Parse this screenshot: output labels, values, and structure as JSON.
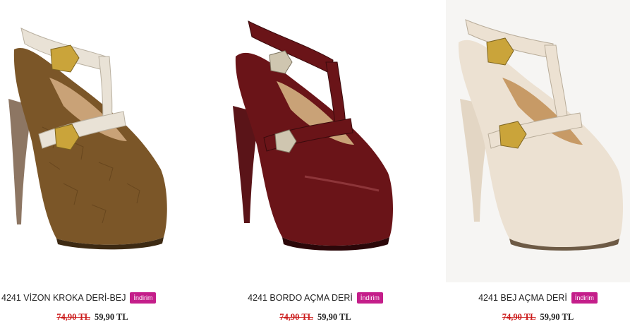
{
  "products": [
    {
      "title": "4241 VİZON KROKA DERİ-BEJ",
      "badge": "İndirim",
      "old_price": "74,90 TL",
      "new_price": "59,90 TL",
      "image": "brown-croc-tstrap-platform-heel",
      "colors": {
        "body": "#7b5628",
        "strap": "#e9e2d6",
        "heel": "#8d7663"
      }
    },
    {
      "title": "4241 BORDO AÇMA DERİ",
      "badge": "İndirim",
      "old_price": "74,90 TL",
      "new_price": "59,90 TL",
      "image": "burgundy-patent-tstrap-platform-heel",
      "colors": {
        "body": "#6a1418",
        "strap": "#6a1418",
        "heel": "#5a1418"
      }
    },
    {
      "title": "4241 BEJ AÇMA DERİ",
      "badge": "İndirim",
      "old_price": "74,90 TL",
      "new_price": "59,90 TL",
      "image": "beige-patent-tstrap-platform-heel",
      "colors": {
        "body": "#ece1d2",
        "strap": "#ece1d2",
        "heel": "#e3d6c4"
      }
    }
  ]
}
